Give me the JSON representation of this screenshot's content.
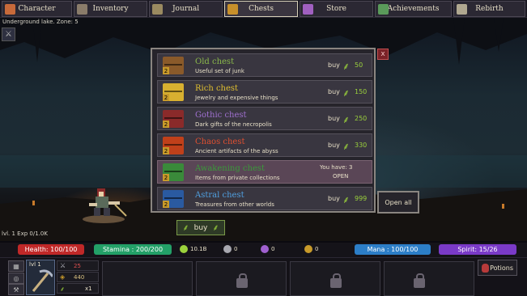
{
  "nav": {
    "tabs": [
      {
        "label": "Character",
        "icon": "helmet-icon",
        "color": "#c86a3a"
      },
      {
        "label": "Inventory",
        "icon": "backpack-icon",
        "color": "#8a7c6a"
      },
      {
        "label": "Journal",
        "icon": "quill-icon",
        "color": "#9a8a60"
      },
      {
        "label": "Chests",
        "icon": "chest-icon",
        "color": "#c8902a",
        "active": true
      },
      {
        "label": "Store",
        "icon": "gems-icon",
        "color": "#a060c0"
      },
      {
        "label": "Achievements",
        "icon": "medal-icon",
        "color": "#5a9a5a"
      },
      {
        "label": "Rebirth",
        "icon": "skull-swirl-icon",
        "color": "#b0a890"
      }
    ]
  },
  "scene": {
    "zone": "Underground lake. Zone: 5",
    "level_exp": "lvl. 1 Exp 0/1.0K"
  },
  "chests": {
    "buy_label": "buy",
    "items": [
      {
        "name": "Old chest",
        "desc": "Useful set of junk",
        "price": "50",
        "count": "2",
        "name_color": "#8ab84a",
        "icon_color": "#8a5a2a"
      },
      {
        "name": "Rich chest",
        "desc": "Jewelry and expensive things",
        "price": "150",
        "count": "2",
        "name_color": "#e0c030",
        "icon_color": "#d8b030"
      },
      {
        "name": "Gothic chest",
        "desc": "Dark gifts of the necropolis",
        "price": "250",
        "count": "2",
        "name_color": "#a070d0",
        "icon_color": "#8a2a2a"
      },
      {
        "name": "Chaos chest",
        "desc": "Ancient artifacts of the abyss",
        "price": "330",
        "count": "2",
        "name_color": "#e05030",
        "icon_color": "#c0401a"
      },
      {
        "name": "Awakening chest",
        "desc": "Items from private collections",
        "have": "You have: 3",
        "action": "OPEN",
        "count": "2",
        "name_color": "#3a9a3a",
        "icon_color": "#3a8a3a",
        "highlighted": true
      },
      {
        "name": "Astral chest",
        "desc": "Treasures from other worlds",
        "price": "999",
        "count": "2",
        "name_color": "#50a0e0",
        "icon_color": "#2a5aa0"
      }
    ],
    "open_all": "Open all",
    "close": "x",
    "center_buy": "buy"
  },
  "stats": {
    "health": "Health: 100/100",
    "stamina": "Stamina : 200/200",
    "leaves": "10.1B",
    "res2": "0",
    "res3": "0",
    "res4": "0",
    "mana": "Mana : 100/100",
    "spirit": "Spirit: 15/26",
    "colors": {
      "health": "#c02828",
      "stamina": "#23a068",
      "mana": "#2c7ec8",
      "spirit": "#7a3ac8"
    }
  },
  "equipment": {
    "lvl": "lvl 1",
    "attack": "25",
    "gold": "440",
    "mult": "x1"
  },
  "potions": "Potions"
}
